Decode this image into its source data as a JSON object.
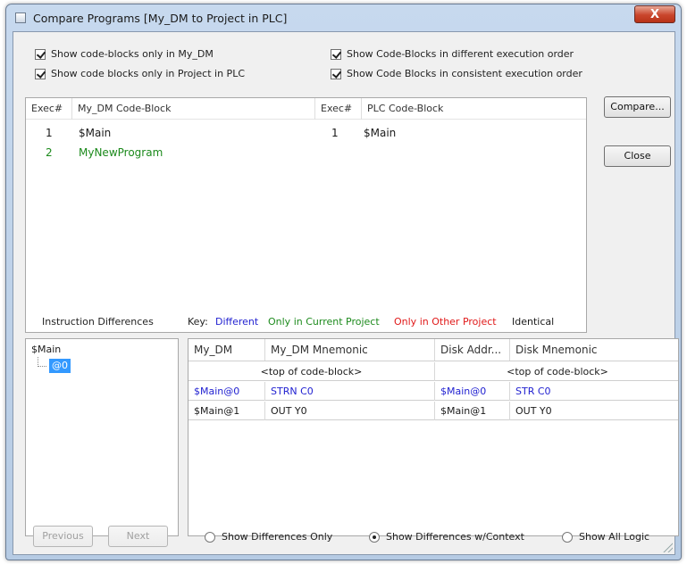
{
  "window": {
    "title": "Compare Programs [My_DM to Project in PLC]",
    "close_glyph": "X"
  },
  "options": [
    {
      "label": "Show code-blocks only in My_DM",
      "checked": true
    },
    {
      "label": "Show code blocks only in Project in PLC",
      "checked": true
    },
    {
      "label": "Show Code-Blocks in different execution order",
      "checked": true
    },
    {
      "label": "Show Code Blocks in consistent execution order",
      "checked": true
    }
  ],
  "blocks_list": {
    "headers": [
      "Exec#",
      "My_DM Code-Block",
      "Exec#",
      "PLC Code-Block"
    ],
    "rows": [
      {
        "exec_left": "1",
        "left_block": "$Main",
        "exec_right": "1",
        "right_block": "$Main",
        "status": "identical"
      },
      {
        "exec_left": "2",
        "left_block": "MyNewProgram",
        "exec_right": "",
        "right_block": "",
        "status": "only-current"
      }
    ]
  },
  "buttons": {
    "compare": "Compare...",
    "close": "Close",
    "previous": "Previous",
    "next": "Next"
  },
  "instruction_differences": {
    "label": "Instruction Differences",
    "tree": {
      "root": "$Main",
      "child": "@0"
    }
  },
  "key": {
    "label": "Key:",
    "different": "Different",
    "only_current": "Only in Current Project",
    "only_other": "Only in Other Project",
    "identical": "Identical"
  },
  "diff_grid": {
    "headers": [
      "My_DM",
      "My_DM Mnemonic",
      "Disk Addr...",
      "Disk Mnemonic"
    ],
    "rows": [
      {
        "left_addr": "",
        "left_mnemonic": "<top of code-block>",
        "right_addr": "",
        "right_mnemonic": "<top of code-block>",
        "status": "identical"
      },
      {
        "left_addr": "$Main@0",
        "left_mnemonic": "STRN C0",
        "right_addr": "$Main@0",
        "right_mnemonic": "STR C0",
        "status": "different"
      },
      {
        "left_addr": "$Main@1",
        "left_mnemonic": "OUT Y0",
        "right_addr": "$Main@1",
        "right_mnemonic": "OUT Y0",
        "status": "identical"
      }
    ]
  },
  "view_modes": [
    {
      "label": "Show Differences Only",
      "selected": false
    },
    {
      "label": "Show Differences w/Context",
      "selected": true
    },
    {
      "label": "Show All Logic",
      "selected": false
    }
  ],
  "colors": {
    "different": "#1f1fd0",
    "only_current": "#1c8a1c",
    "only_other": "#e01818",
    "identical": "#1a1a1a",
    "selection": "#3399ff"
  }
}
